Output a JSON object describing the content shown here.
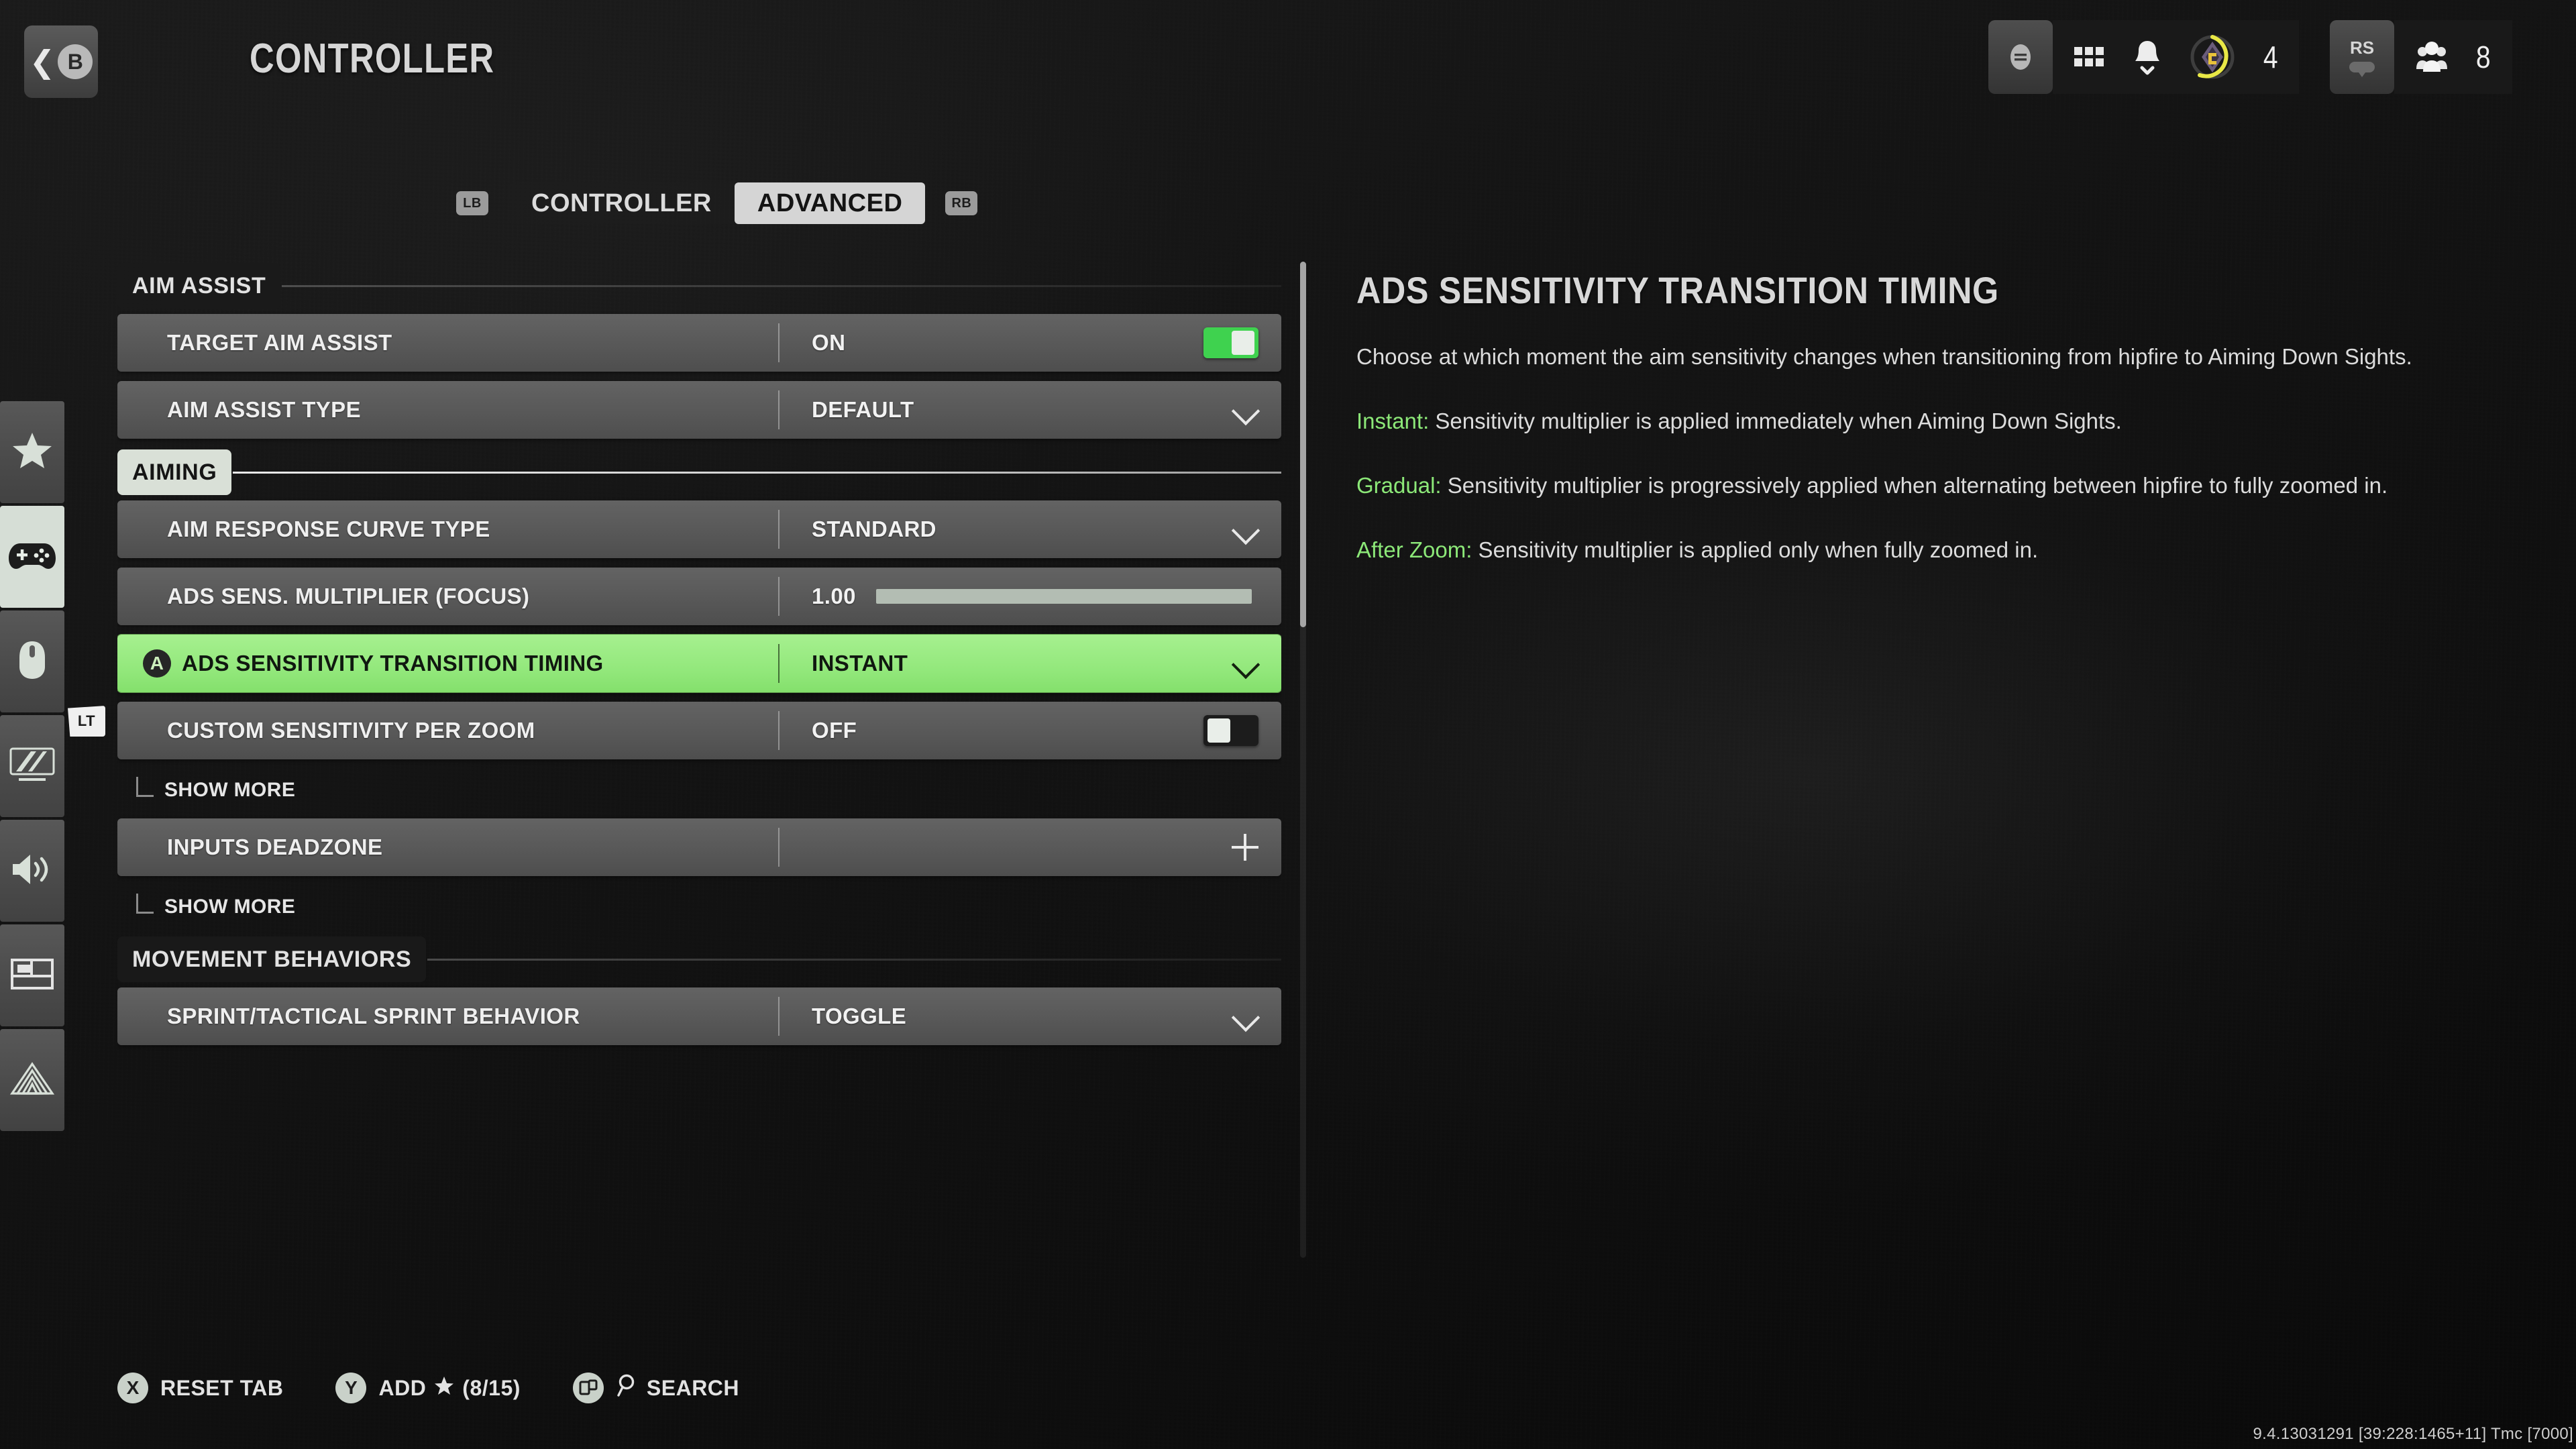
{
  "header": {
    "back_glyph": "B",
    "title": "CONTROLLER"
  },
  "hud": {
    "menu_icon": "menu-pill-icon",
    "grid_icon": "grid-icon",
    "bell_icon": "notification-bell-icon",
    "currency_icon": "battlepass-token-icon",
    "currency_count": "4",
    "stick_glyph": "RS",
    "party_icon": "party-members-icon",
    "party_count": "8"
  },
  "rail": {
    "items": [
      {
        "name": "favorites",
        "icon": "star-icon"
      },
      {
        "name": "controller",
        "icon": "gamepad-icon",
        "active": true
      },
      {
        "name": "mouse-keyboard",
        "icon": "mouse-icon"
      },
      {
        "name": "graphics",
        "icon": "display-icon"
      },
      {
        "name": "audio",
        "icon": "speaker-icon"
      },
      {
        "name": "interface",
        "icon": "hud-layout-icon"
      },
      {
        "name": "accessibility",
        "icon": "radar-icon"
      }
    ],
    "trigger_badge": "LT"
  },
  "tabs": {
    "left_bumper": "LB",
    "right_bumper": "RB",
    "items": [
      {
        "label": "CONTROLLER",
        "active": false
      },
      {
        "label": "ADVANCED",
        "active": true
      }
    ]
  },
  "settings": {
    "sections": [
      {
        "title": "AIM ASSIST",
        "highlighted": false,
        "rows": [
          {
            "label": "TARGET AIM ASSIST",
            "value": "ON",
            "control": "toggle",
            "toggle_state": "on",
            "selected": false
          },
          {
            "label": "AIM ASSIST TYPE",
            "value": "DEFAULT",
            "control": "chevron",
            "selected": false
          }
        ]
      },
      {
        "title": "AIMING",
        "highlighted": true,
        "rows": [
          {
            "label": "AIM RESPONSE CURVE TYPE",
            "value": "STANDARD",
            "control": "chevron",
            "selected": false
          },
          {
            "label": "ADS SENS. MULTIPLIER (FOCUS)",
            "value": "1.00",
            "control": "slider",
            "slider_percent": 100,
            "selected": false
          },
          {
            "label": "ADS SENSITIVITY TRANSITION TIMING",
            "value": "INSTANT",
            "control": "chevron",
            "selected": true,
            "action_glyph": "A"
          },
          {
            "label": "CUSTOM SENSITIVITY PER ZOOM",
            "value": "OFF",
            "control": "toggle",
            "toggle_state": "off",
            "selected": false,
            "sub_link": "SHOW MORE"
          },
          {
            "label": "INPUTS DEADZONE",
            "value": "",
            "control": "plus",
            "selected": false,
            "sub_link": "SHOW MORE"
          }
        ]
      },
      {
        "title": "MOVEMENT BEHAVIORS",
        "highlighted": false,
        "rows": [
          {
            "label": "SPRINT/TACTICAL SPRINT BEHAVIOR",
            "value": "TOGGLE",
            "control": "chevron",
            "selected": false
          }
        ]
      }
    ]
  },
  "detail": {
    "title": "ADS SENSITIVITY TRANSITION TIMING",
    "paragraphs": [
      {
        "highlight": "",
        "text": "Choose at which moment the aim sensitivity changes when transitioning from hipfire to Aiming Down Sights."
      },
      {
        "highlight": "Instant:",
        "text": " Sensitivity multiplier is applied immediately when Aiming Down Sights."
      },
      {
        "highlight": "Gradual:",
        "text": " Sensitivity multiplier is progressively applied when alternating between hipfire to fully zoomed in."
      },
      {
        "highlight": "After Zoom:",
        "text": " Sensitivity multiplier is applied only when fully zoomed in."
      }
    ]
  },
  "footer": {
    "buttons": [
      {
        "glyph": "X",
        "label": "RESET TAB",
        "star": false,
        "count": ""
      },
      {
        "glyph": "Y",
        "label": "ADD",
        "star": true,
        "count": "(8/15)"
      },
      {
        "glyph": "",
        "label": "SEARCH",
        "icon": "search-icon",
        "pad_glyph": "view-button-icon"
      }
    ],
    "version": "9.4.13031291 [39:228:1465+11] Tmc [7000]"
  },
  "colors": {
    "accent_green": "#8ce878",
    "selected_row": "#93e87c",
    "toggle_on": "#3fd24f",
    "panel_gray": "#585858",
    "token_yellow": "#e9e846"
  }
}
